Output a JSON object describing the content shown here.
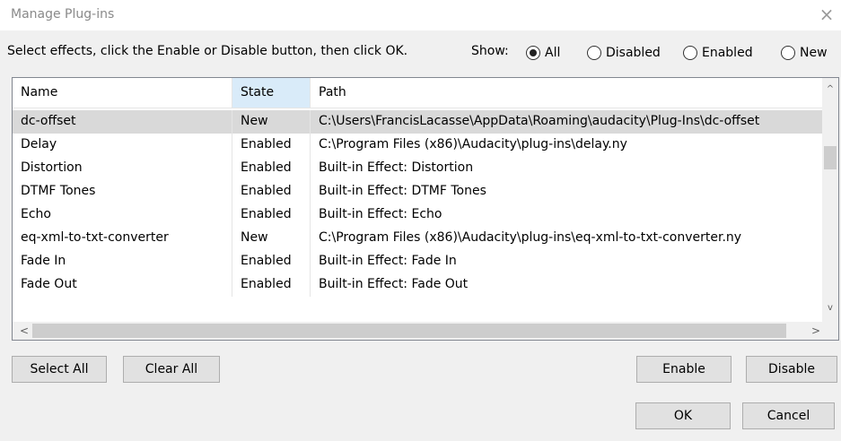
{
  "window": {
    "title": "Manage Plug-ins",
    "close_glyph": "×"
  },
  "instructions": "Select effects, click the Enable or Disable button, then click OK.",
  "show": {
    "label": "Show:",
    "options": [
      {
        "label": "All",
        "checked": true
      },
      {
        "label": "Disabled",
        "checked": false
      },
      {
        "label": "Enabled",
        "checked": false
      },
      {
        "label": "New",
        "checked": false
      }
    ]
  },
  "table": {
    "columns": [
      "Name",
      "State",
      "Path"
    ],
    "sorted_column": "State",
    "rows": [
      {
        "name": "dc-offset",
        "state": "New",
        "path": "C:\\Users\\FrancisLacasse\\AppData\\Roaming\\audacity\\Plug-Ins\\dc-offset",
        "selected": true
      },
      {
        "name": "Delay",
        "state": "Enabled",
        "path": "C:\\Program Files (x86)\\Audacity\\plug-ins\\delay.ny",
        "selected": false
      },
      {
        "name": "Distortion",
        "state": "Enabled",
        "path": "Built-in Effect: Distortion",
        "selected": false
      },
      {
        "name": "DTMF Tones",
        "state": "Enabled",
        "path": "Built-in Effect: DTMF Tones",
        "selected": false
      },
      {
        "name": "Echo",
        "state": "Enabled",
        "path": "Built-in Effect: Echo",
        "selected": false
      },
      {
        "name": "eq-xml-to-txt-converter",
        "state": "New",
        "path": "C:\\Program Files (x86)\\Audacity\\plug-ins\\eq-xml-to-txt-converter.ny",
        "selected": false
      },
      {
        "name": "Fade In",
        "state": "Enabled",
        "path": "Built-in Effect: Fade In",
        "selected": false
      },
      {
        "name": "Fade Out",
        "state": "Enabled",
        "path": "Built-in Effect: Fade Out",
        "selected": false
      }
    ]
  },
  "scrollbars": {
    "up_glyph": "^",
    "down_glyph": "v",
    "left_glyph": "<",
    "right_glyph": ">"
  },
  "buttons": {
    "select_all": "Select All",
    "clear_all": "Clear All",
    "enable": "Enable",
    "disable": "Disable",
    "ok": "OK",
    "cancel": "Cancel"
  },
  "colors": {
    "selected_row": "#d9d9d9",
    "sorted_header": "#d9ebf9",
    "button_face": "#e1e1e1"
  }
}
